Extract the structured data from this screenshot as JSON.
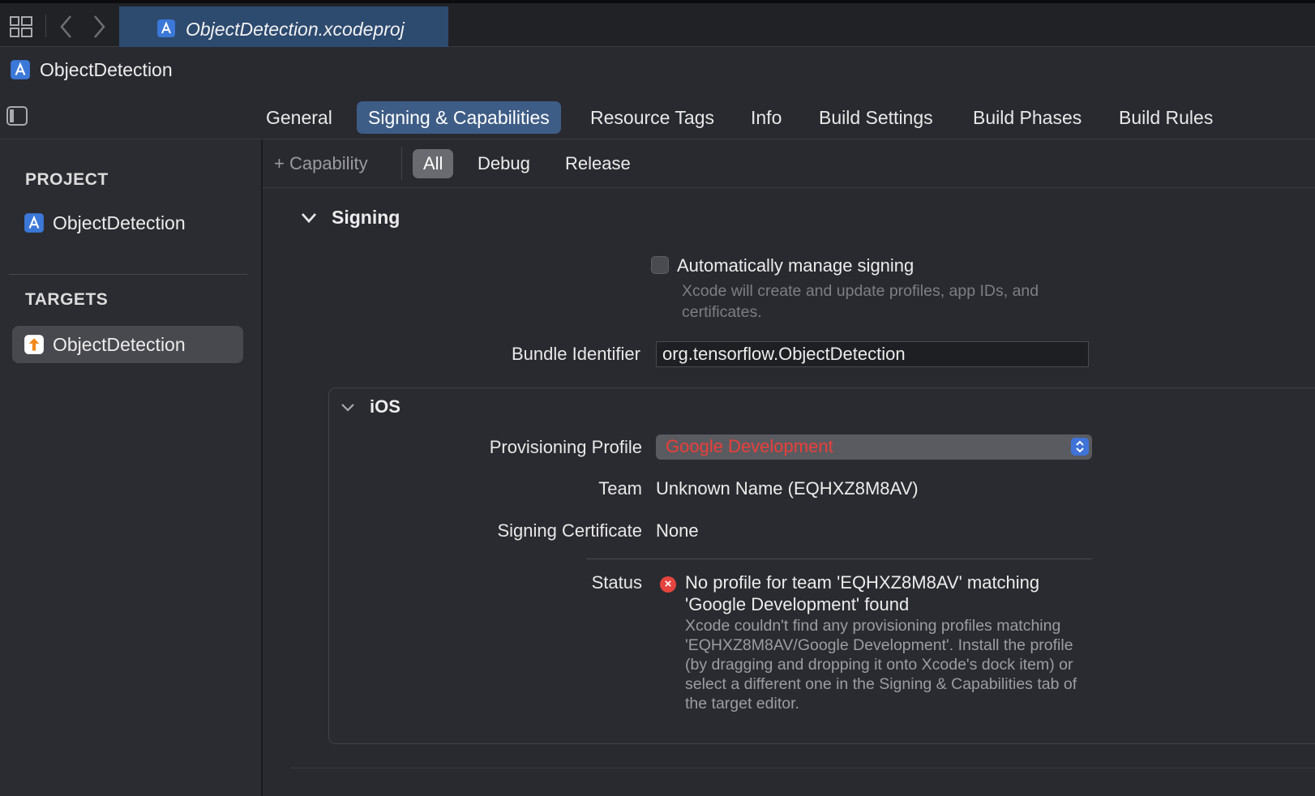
{
  "window": {
    "file_tab": "ObjectDetection.xcodeproj",
    "breadcrumb": "ObjectDetection"
  },
  "editor_tabs": [
    {
      "label": "General",
      "active": false
    },
    {
      "label": "Signing & Capabilities",
      "active": true
    },
    {
      "label": "Resource Tags",
      "active": false
    },
    {
      "label": "Info",
      "active": false
    },
    {
      "label": "Build Settings",
      "active": false
    },
    {
      "label": "Build Phases",
      "active": false
    },
    {
      "label": "Build Rules",
      "active": false
    }
  ],
  "sidebar": {
    "project_heading": "PROJECT",
    "project_item": "ObjectDetection",
    "targets_heading": "TARGETS",
    "target_item": "ObjectDetection"
  },
  "subbar": {
    "add_capability": "+ Capability",
    "filters": [
      {
        "label": "All",
        "active": true
      },
      {
        "label": "Debug",
        "active": false
      },
      {
        "label": "Release",
        "active": false
      }
    ]
  },
  "signing": {
    "section_title": "Signing",
    "auto_manage_label": "Automatically manage signing",
    "auto_manage_checked": false,
    "auto_manage_help": "Xcode will create and update profiles, app IDs, and certificates.",
    "bundle_id_label": "Bundle Identifier",
    "bundle_id_value": "org.tensorflow.ObjectDetection"
  },
  "ios": {
    "section_title": "iOS",
    "profile_label": "Provisioning Profile",
    "profile_value": "Google Development",
    "team_label": "Team",
    "team_value": "Unknown Name (EQHXZ8M8AV)",
    "cert_label": "Signing Certificate",
    "cert_value": "None",
    "status_label": "Status",
    "status_title": "No profile for team 'EQHXZ8M8AV' matching 'Google Development' found",
    "status_desc": "Xcode couldn't find any provisioning profiles matching 'EQHXZ8M8AV/Google Development'. Install the profile (by dragging and dropping it onto Xcode's dock item) or select a different one in the Signing & Capabilities tab of the target editor."
  },
  "colors": {
    "accent": "#3e5d86",
    "error": "#e5443f",
    "profile_error_text": "#ea3f3a"
  }
}
